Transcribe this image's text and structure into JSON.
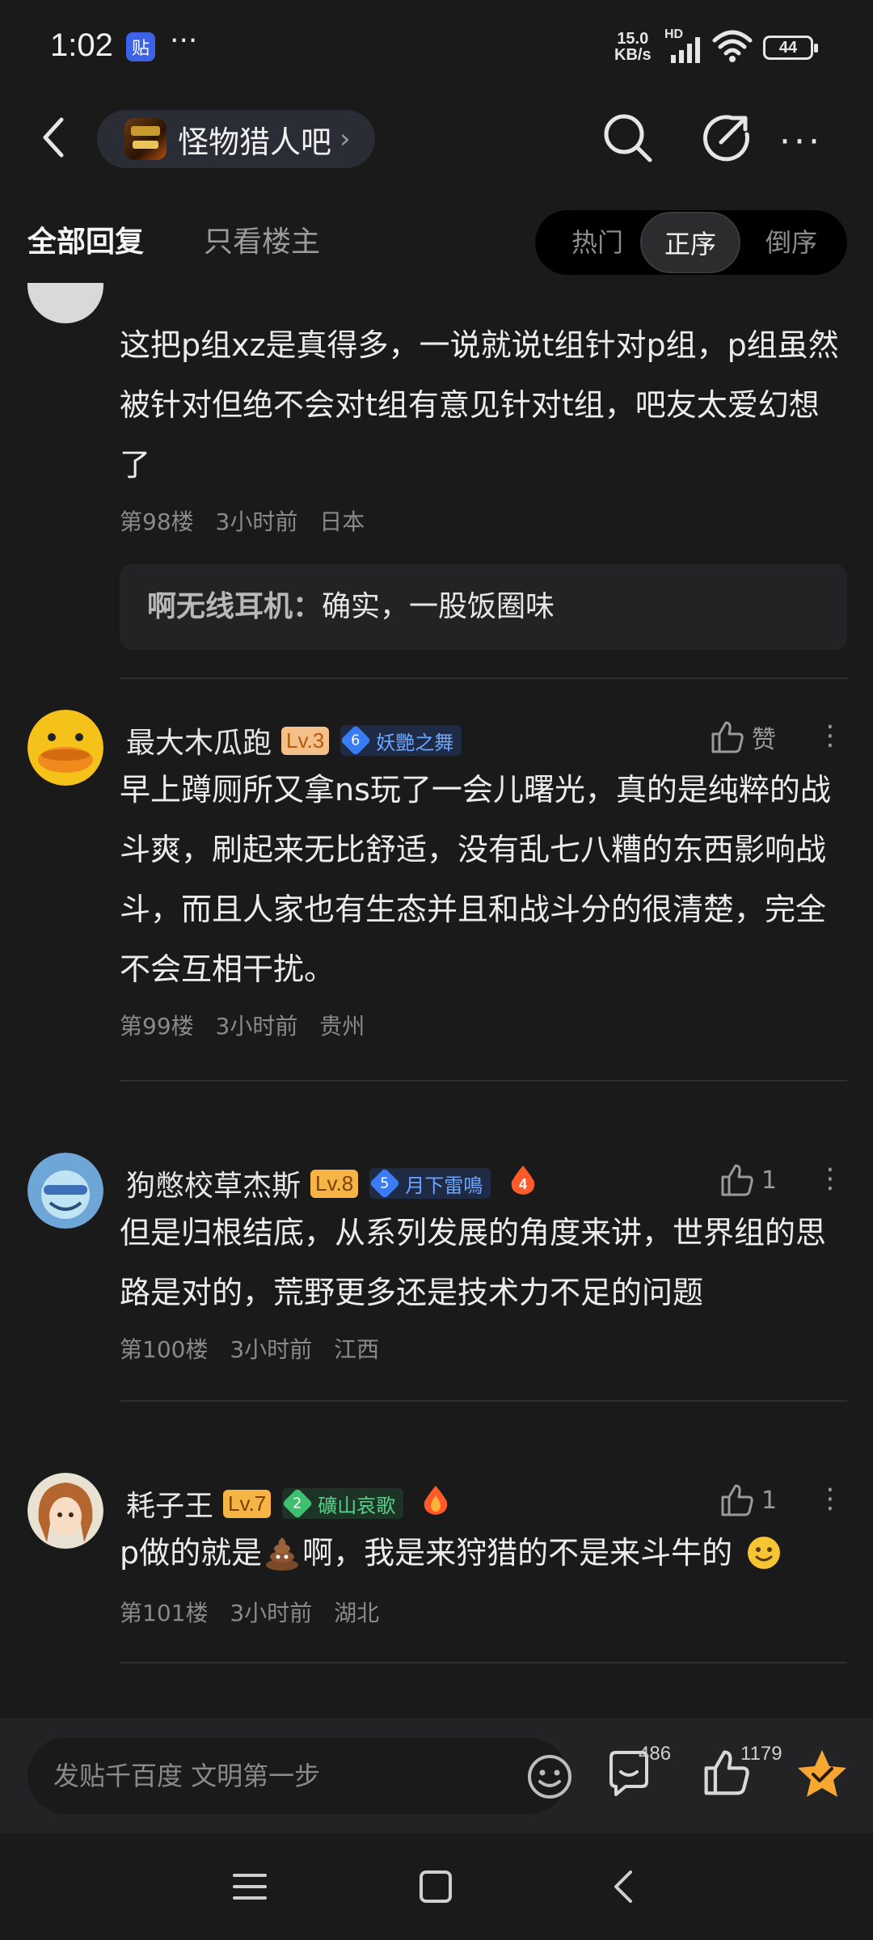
{
  "status_bar": {
    "time": "1:02",
    "app_badge": "贴",
    "more": "···",
    "net_speed": "15.0",
    "net_unit": "KB/s",
    "net_hd": "HD",
    "battery": "44"
  },
  "nav": {
    "forum_name": "怪物猎人吧",
    "more": "···"
  },
  "tabs": {
    "all_replies": "全部回复",
    "op_only": "只看楼主",
    "sort": [
      "热门",
      "正序",
      "倒序"
    ],
    "sort_selected": "正序"
  },
  "posts": [
    {
      "text": "这把p组xz是真得多，一说就说t组针对p组，p组虽然被针对但绝不会对t组有意见针对t组，吧友太爱幻想了",
      "floor": "第98楼",
      "time": "3小时前",
      "location": "日本",
      "sub_reply": {
        "user": "啊无线耳机：",
        "text": "确实，一股饭圈味"
      }
    },
    {
      "username": "最大木瓜跑",
      "level": "Lv.3",
      "badge_level": "6",
      "badge_name": "妖艷之舞",
      "like_label": "赞",
      "text": "早上蹲厕所又拿ns玩了一会儿曙光，真的是纯粹的战斗爽，刷起来无比舒适，没有乱七八糟的东西影响战斗，而且人家也有生态并且和战斗分的很清楚，完全不会互相干扰。",
      "floor": "第99楼",
      "time": "3小时前",
      "location": "贵州"
    },
    {
      "username": "狗憋校草杰斯",
      "level": "Lv.8",
      "badge_level": "5",
      "badge_name": "月下雷鳴",
      "fire_count": "4",
      "like_count": "1",
      "text": "但是归根结底，从系列发展的角度来讲，世界组的思路是对的，荒野更多还是技术力不足的问题",
      "floor": "第100楼",
      "time": "3小时前",
      "location": "江西"
    },
    {
      "username": "耗子王",
      "level": "Lv.7",
      "badge_level": "2",
      "badge_name": "礦山哀歌",
      "like_count": "1",
      "text_before": "p做的就是",
      "text_after": "啊，我是来狩猎的不是来斗牛的",
      "floor": "第101楼",
      "time": "3小时前",
      "location": "湖北"
    }
  ],
  "composer": {
    "placeholder": "发贴千百度 文明第一步",
    "reply_count": "486",
    "like_count": "1179"
  },
  "icons": {
    "back": "chevron-left-icon",
    "search": "search-icon",
    "share": "share-icon",
    "emoji": "emoji-icon",
    "reply": "comment-icon",
    "thumb": "thumbs-up-icon",
    "star": "star-icon",
    "menu": "menu-icon",
    "home": "home-icon",
    "sys_back": "back-icon"
  },
  "colors": {
    "background": "#1a1a1b",
    "accent_star": "#f7a731",
    "level_orange": "#f3c08a",
    "level_gold": "#f6b445",
    "badge_blue": "#3a7cf6",
    "badge_green": "#3fbf72"
  }
}
